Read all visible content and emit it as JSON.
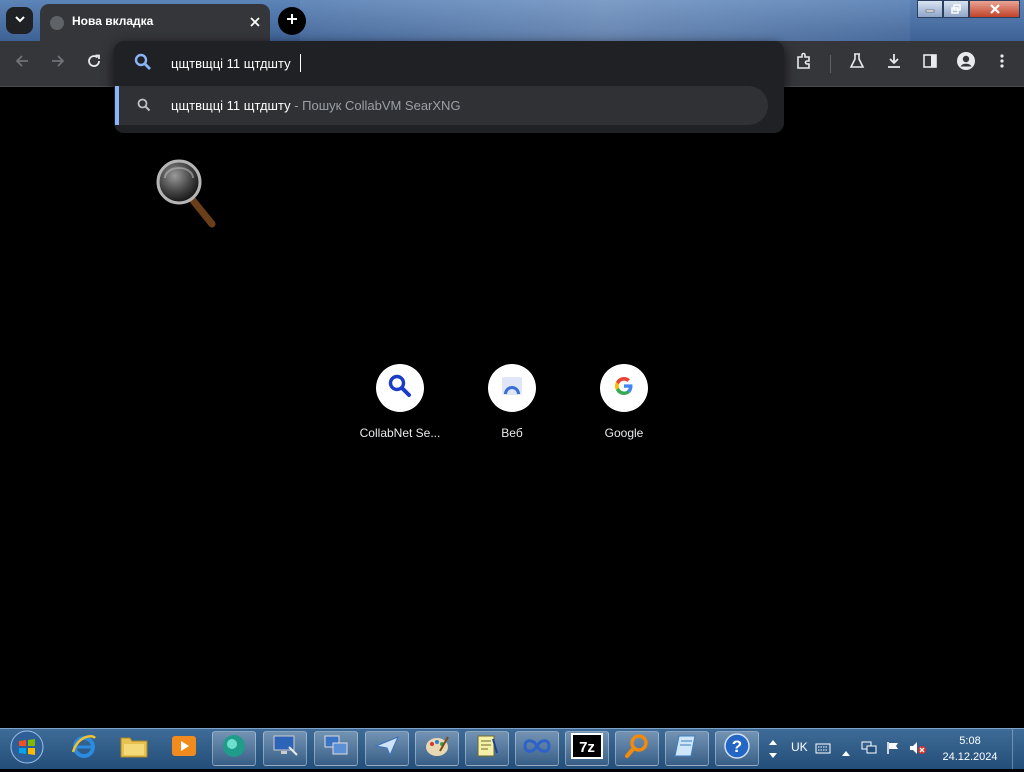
{
  "tab": {
    "title": "Нова вкладка"
  },
  "omnibox": {
    "input_value": "цщтвщці 11 щтдшту",
    "suggestion": {
      "text": "цщтвщці 11 щтдшту",
      "subtitle": "- Пошук CollabVM SearXNG"
    }
  },
  "shortcuts": [
    {
      "label": "CollabNet Se...",
      "icon": "search-icon"
    },
    {
      "label": "Веб",
      "icon": "web-icon"
    },
    {
      "label": "Google",
      "icon": "google-icon"
    }
  ],
  "taskbar": {
    "items": [
      "internet-explorer-icon",
      "file-explorer-icon",
      "media-player-icon",
      "sphere-app-icon",
      "remote-desktop-icon",
      "network-monitor-icon",
      "paper-plane-app-icon",
      "paint-app-icon",
      "notepad-app-icon",
      "infinity-app-icon",
      "7zip-icon",
      "search-tool-icon",
      "document-app-icon",
      "help-icon"
    ],
    "language": "UK",
    "time": "5:08",
    "date": "24.12.2024"
  },
  "colors": {
    "accent": "#8ab4f8",
    "toolbar": "#35363a",
    "omnibox": "#202124",
    "suggestion": "#303134"
  }
}
